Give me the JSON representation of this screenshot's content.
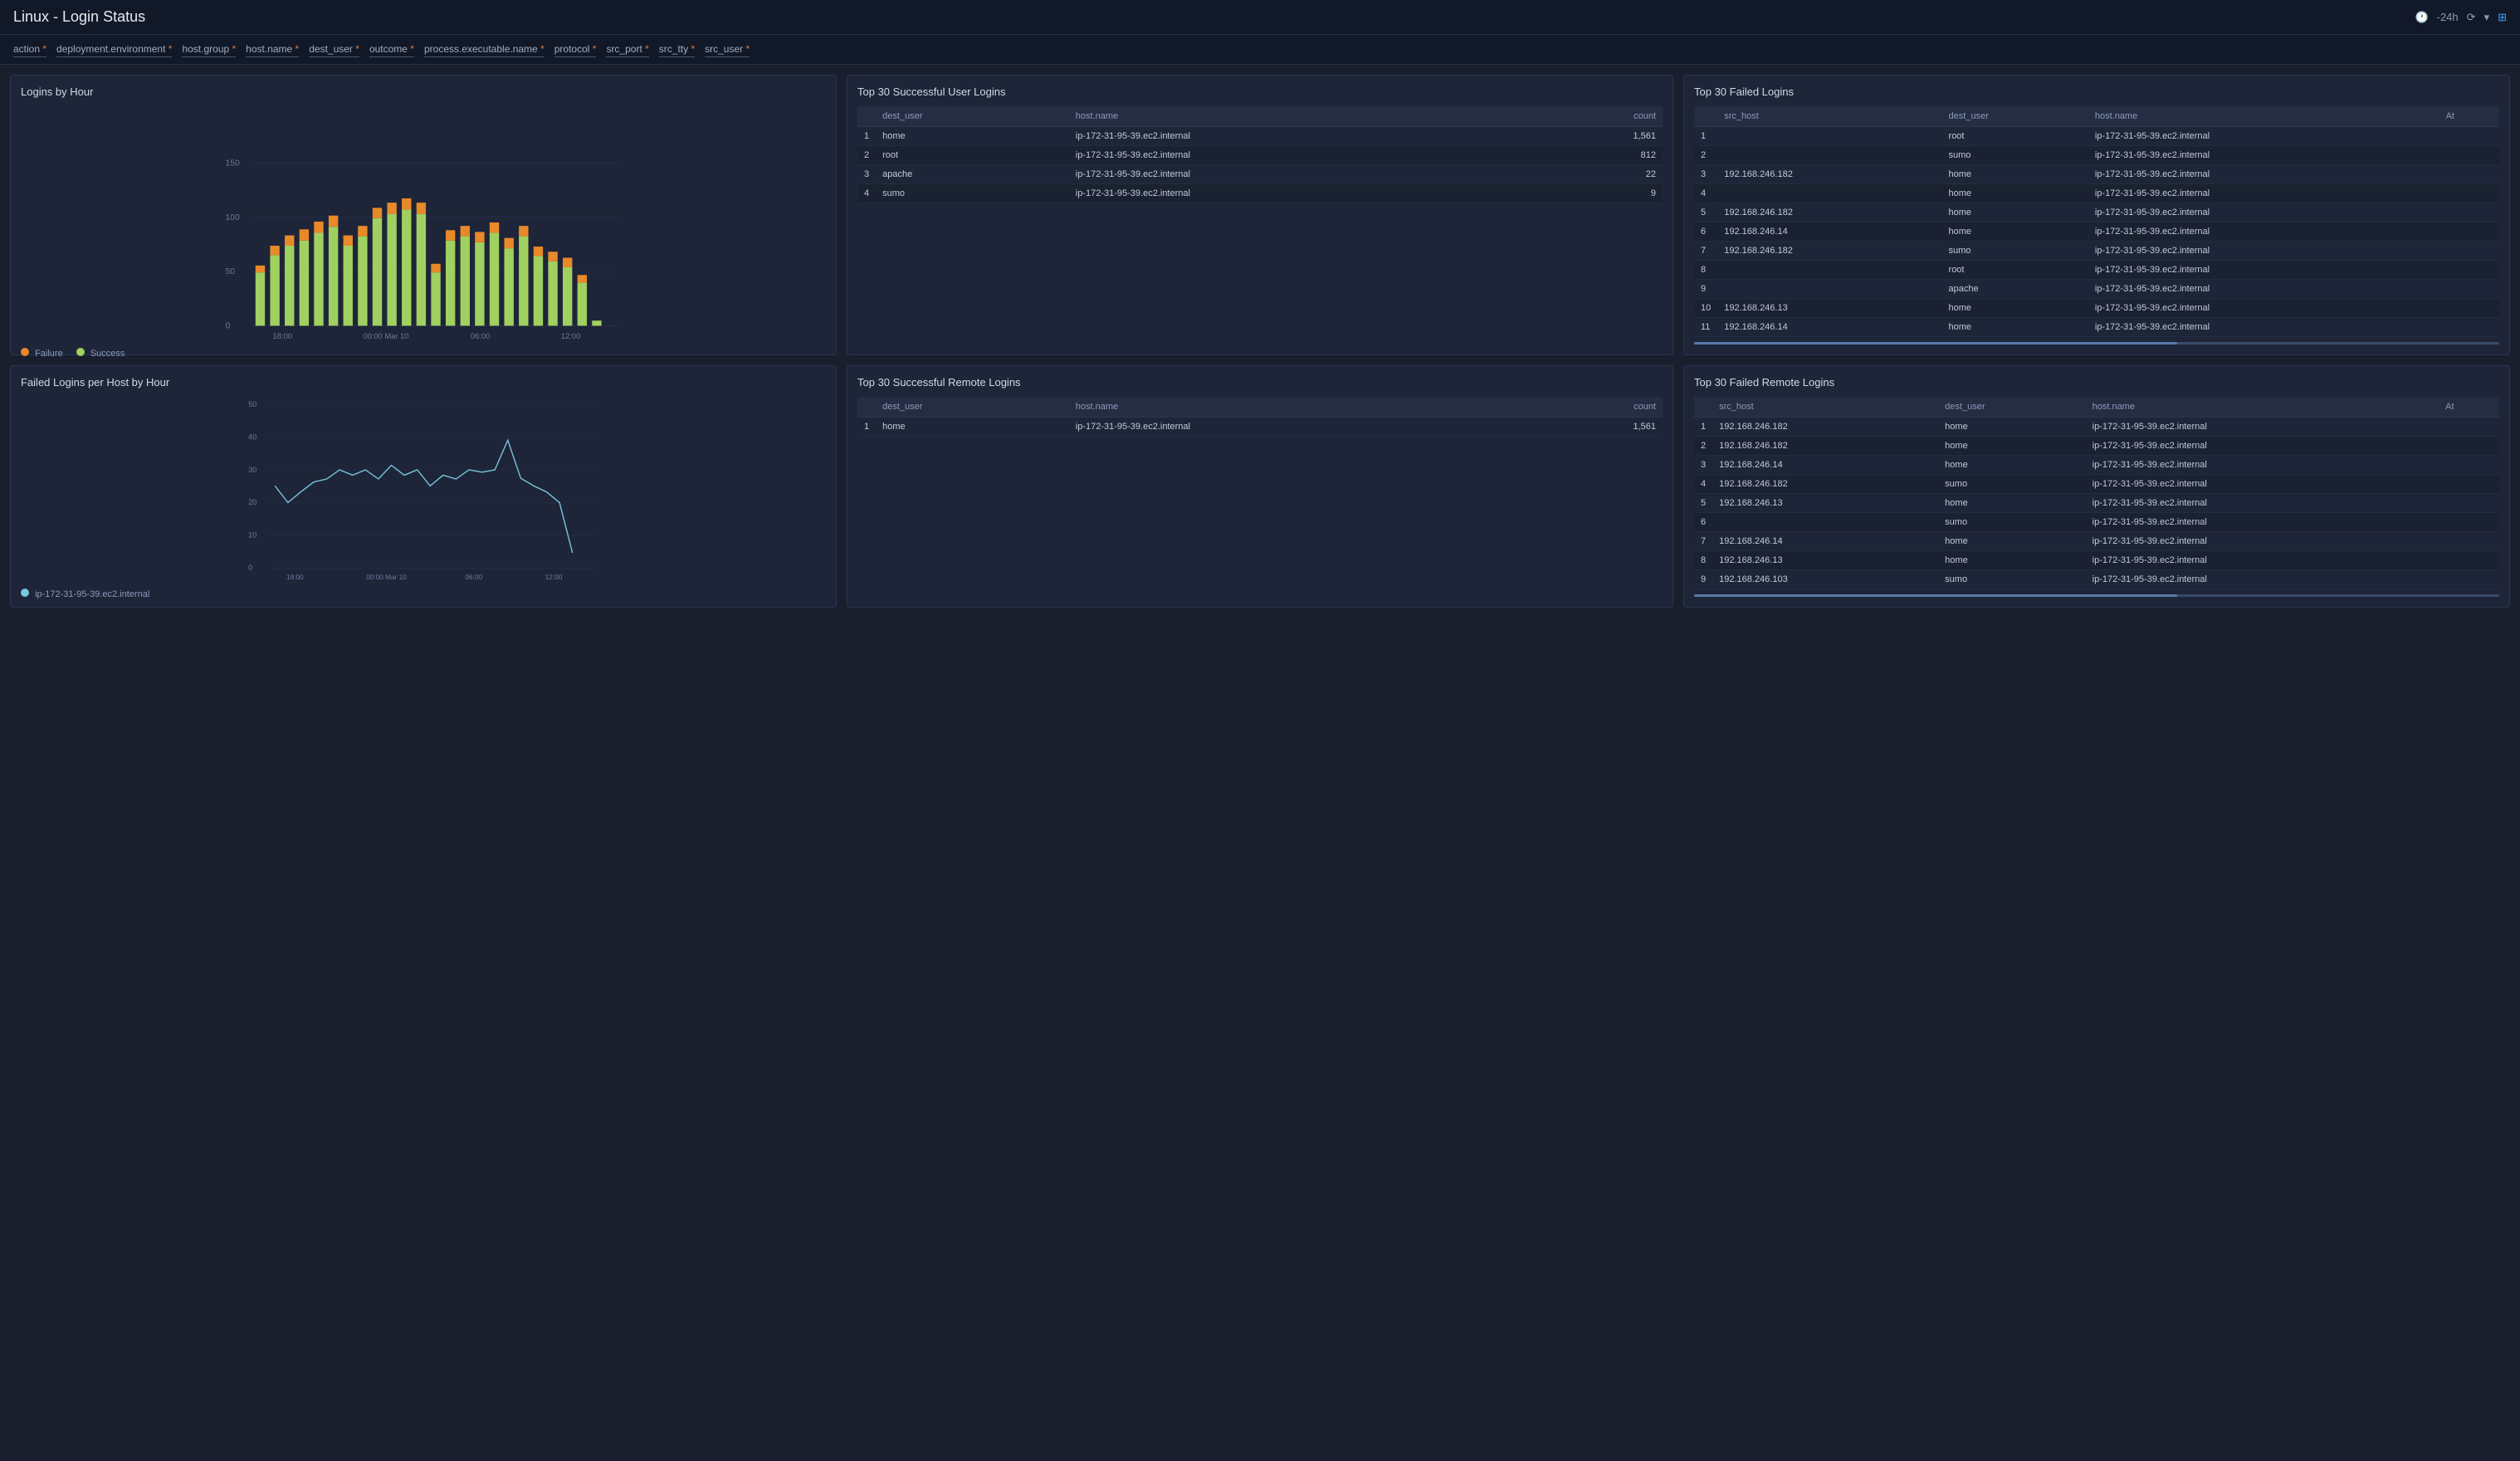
{
  "header": {
    "title": "Linux - Login Status",
    "time_range": "-24h",
    "refresh_icon": "⟳",
    "filter_icon": "⊞"
  },
  "filter_bar": {
    "chips": [
      {
        "label": "action",
        "asterisk": true
      },
      {
        "label": "deployment.environment",
        "asterisk": true
      },
      {
        "label": "host.group",
        "asterisk": true
      },
      {
        "label": "host.name",
        "asterisk": true
      },
      {
        "label": "dest_user",
        "asterisk": true
      },
      {
        "label": "outcome",
        "asterisk": true
      },
      {
        "label": "process.executable.name",
        "asterisk": true
      },
      {
        "label": "protocol",
        "asterisk": true
      },
      {
        "label": "src_port",
        "asterisk": true
      },
      {
        "label": "src_tty",
        "asterisk": true
      },
      {
        "label": "src_user",
        "asterisk": true
      }
    ]
  },
  "logins_by_hour": {
    "title": "Logins by Hour",
    "y_labels": [
      "0",
      "50",
      "100",
      "150"
    ],
    "x_labels": [
      "18:00",
      "00:00 Mar 10",
      "06:00",
      "12:00"
    ],
    "legend": [
      {
        "label": "Failure",
        "color": "#e8892a"
      },
      {
        "label": "Success",
        "color": "#a0d060"
      }
    ]
  },
  "failed_logins_per_host": {
    "title": "Failed Logins per Host by Hour",
    "y_labels": [
      "0",
      "10",
      "20",
      "30",
      "40",
      "50"
    ],
    "x_labels": [
      "18:00",
      "00:00 Mar 10",
      "06:00",
      "12:00"
    ],
    "legend_host": "ip-172-31-95-39.ec2.internal"
  },
  "top30_successful": {
    "title": "Top 30 Successful User Logins",
    "columns": [
      "dest_user",
      "host.name",
      "count"
    ],
    "rows": [
      {
        "num": 1,
        "dest_user": "home",
        "hostname": "ip-172-31-95-39.ec2.internal",
        "count": "1,561"
      },
      {
        "num": 2,
        "dest_user": "root",
        "hostname": "ip-172-31-95-39.ec2.internal",
        "count": "812"
      },
      {
        "num": 3,
        "dest_user": "apache",
        "hostname": "ip-172-31-95-39.ec2.internal",
        "count": "22"
      },
      {
        "num": 4,
        "dest_user": "sumo",
        "hostname": "ip-172-31-95-39.ec2.internal",
        "count": "9"
      }
    ]
  },
  "top30_failed": {
    "title": "Top 30 Failed Logins",
    "columns": [
      "src_host",
      "dest_user",
      "host.name",
      "At"
    ],
    "rows": [
      {
        "num": 1,
        "src_host": "",
        "dest_user": "root",
        "hostname": "ip-172-31-95-39.ec2.internal"
      },
      {
        "num": 2,
        "src_host": "",
        "dest_user": "sumo",
        "hostname": "ip-172-31-95-39.ec2.internal"
      },
      {
        "num": 3,
        "src_host": "192.168.246.182",
        "dest_user": "home",
        "hostname": "ip-172-31-95-39.ec2.internal"
      },
      {
        "num": 4,
        "src_host": "",
        "dest_user": "home",
        "hostname": "ip-172-31-95-39.ec2.internal"
      },
      {
        "num": 5,
        "src_host": "192.168.246.182",
        "dest_user": "home",
        "hostname": "ip-172-31-95-39.ec2.internal"
      },
      {
        "num": 6,
        "src_host": "192.168.246.14",
        "dest_user": "home",
        "hostname": "ip-172-31-95-39.ec2.internal"
      },
      {
        "num": 7,
        "src_host": "192.168.246.182",
        "dest_user": "sumo",
        "hostname": "ip-172-31-95-39.ec2.internal"
      },
      {
        "num": 8,
        "src_host": "",
        "dest_user": "root",
        "hostname": "ip-172-31-95-39.ec2.internal"
      },
      {
        "num": 9,
        "src_host": "",
        "dest_user": "apache",
        "hostname": "ip-172-31-95-39.ec2.internal"
      },
      {
        "num": 10,
        "src_host": "192.168.246.13",
        "dest_user": "home",
        "hostname": "ip-172-31-95-39.ec2.internal"
      },
      {
        "num": 11,
        "src_host": "192.168.246.14",
        "dest_user": "home",
        "hostname": "ip-172-31-95-39.ec2.internal"
      }
    ]
  },
  "top30_successful_remote": {
    "title": "Top 30 Successful Remote Logins",
    "columns": [
      "dest_user",
      "host.name",
      "count"
    ],
    "rows": [
      {
        "num": 1,
        "dest_user": "home",
        "hostname": "ip-172-31-95-39.ec2.internal",
        "count": "1,561"
      }
    ]
  },
  "top30_failed_remote": {
    "title": "Top 30 Failed Remote Logins",
    "columns": [
      "src_host",
      "dest_user",
      "host.name",
      "At"
    ],
    "rows": [
      {
        "num": 1,
        "src_host": "192.168.246.182",
        "dest_user": "home",
        "hostname": "ip-172-31-95-39.ec2.internal"
      },
      {
        "num": 2,
        "src_host": "192.168.246.182",
        "dest_user": "home",
        "hostname": "ip-172-31-95-39.ec2.internal"
      },
      {
        "num": 3,
        "src_host": "192.168.246.14",
        "dest_user": "home",
        "hostname": "ip-172-31-95-39.ec2.internal"
      },
      {
        "num": 4,
        "src_host": "192.168.246.182",
        "dest_user": "sumo",
        "hostname": "ip-172-31-95-39.ec2.internal"
      },
      {
        "num": 5,
        "src_host": "192.168.246.13",
        "dest_user": "home",
        "hostname": "ip-172-31-95-39.ec2.internal"
      },
      {
        "num": 6,
        "src_host": "",
        "dest_user": "sumo",
        "hostname": "ip-172-31-95-39.ec2.internal"
      },
      {
        "num": 7,
        "src_host": "192.168.246.14",
        "dest_user": "home",
        "hostname": "ip-172-31-95-39.ec2.internal"
      },
      {
        "num": 8,
        "src_host": "192.168.246.13",
        "dest_user": "home",
        "hostname": "ip-172-31-95-39.ec2.internal"
      },
      {
        "num": 9,
        "src_host": "192.168.246.103",
        "dest_user": "sumo",
        "hostname": "ip-172-31-95-39.ec2.internal"
      }
    ]
  }
}
